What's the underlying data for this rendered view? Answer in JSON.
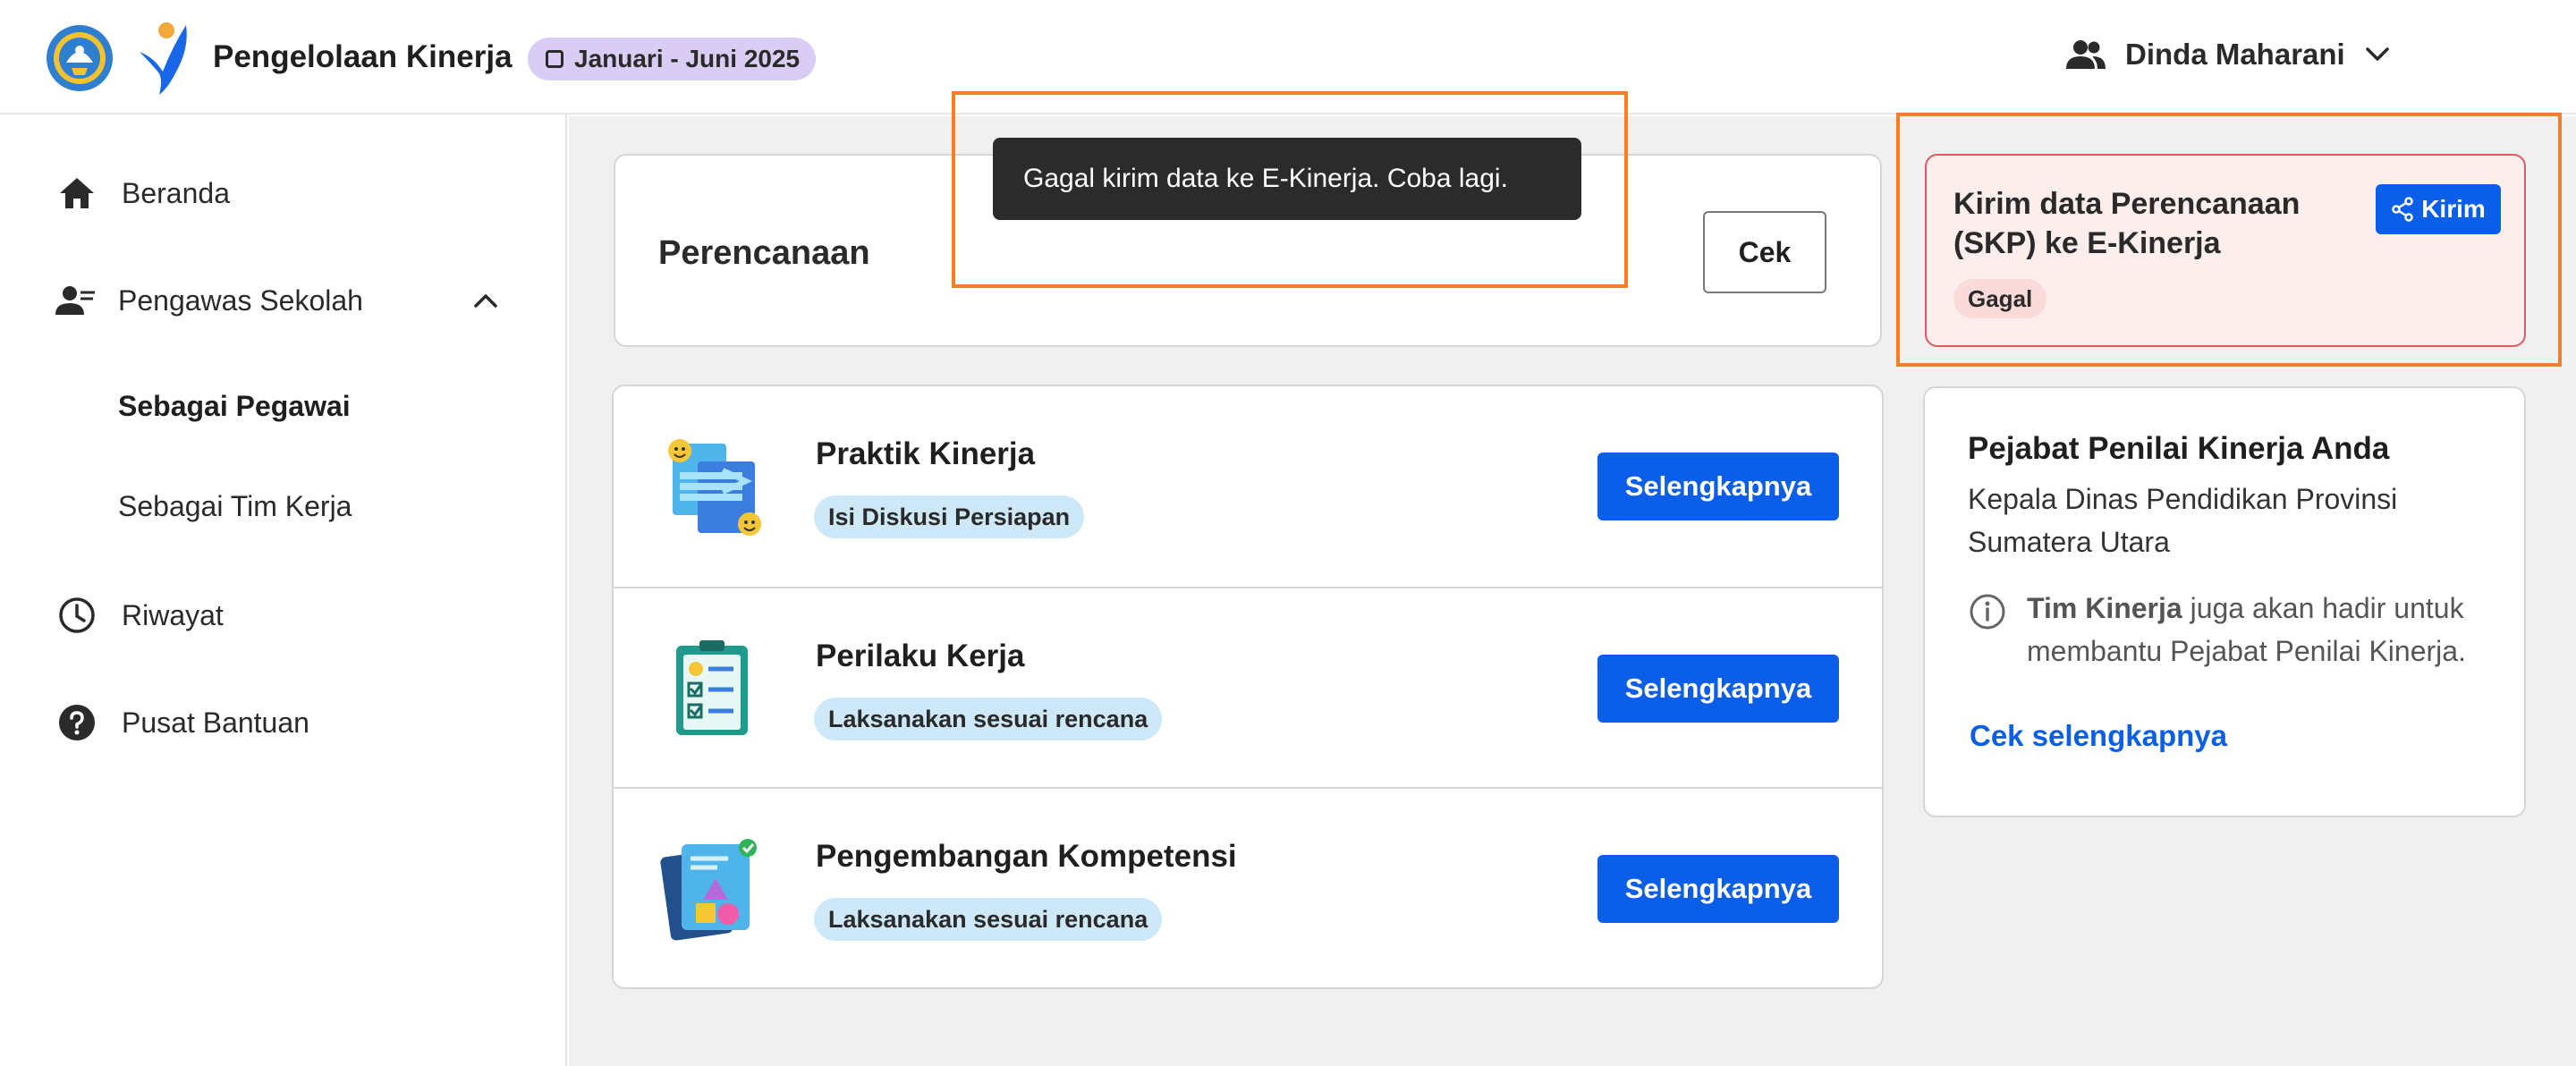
{
  "header": {
    "app_title": "Pengelolaan Kinerja",
    "period_label": "Januari - Juni 2025",
    "user_name": "Dinda Maharani"
  },
  "sidebar": {
    "items": [
      {
        "label": "Beranda",
        "icon": "home-icon"
      },
      {
        "label": "Pengawas Sekolah",
        "icon": "users-icon",
        "expanded": true
      },
      {
        "label": "Riwayat",
        "icon": "clock-icon"
      },
      {
        "label": "Pusat Bantuan",
        "icon": "help-icon"
      }
    ],
    "subitems": [
      {
        "label": "Sebagai Pegawai",
        "active": true
      },
      {
        "label": "Sebagai Tim Kerja",
        "active": false
      }
    ]
  },
  "toast": {
    "message": "Gagal kirim data ke E-Kinerja. Coba lagi."
  },
  "plan_card": {
    "title": "Perencanaan",
    "button_label": "Cek"
  },
  "rows": [
    {
      "title": "Praktik Kinerja",
      "badge": "Isi Diskusi Persiapan",
      "button_label": "Selengkapnya"
    },
    {
      "title": "Perilaku Kerja",
      "badge": "Laksanakan sesuai rencana",
      "button_label": "Selengkapnya"
    },
    {
      "title": "Pengembangan Kompetensi",
      "badge": "Laksanakan sesuai rencana",
      "button_label": "Selengkapnya"
    }
  ],
  "send_card": {
    "title": "Kirim data Perencanaan (SKP) ke E-Kinerja",
    "button_label": "Kirim",
    "status": "Gagal"
  },
  "pejabat_card": {
    "title": "Pejabat Penilai Kinerja Anda",
    "subtitle": "Kepala Dinas Pendidikan Provinsi Sumatera Utara",
    "info_bold": "Tim Kinerja",
    "info_rest": " juga akan hadir untuk membantu Pejabat Penilai Kinerja.",
    "link_label": "Cek selengkapnya"
  },
  "colors": {
    "primary": "#0b5ee8",
    "highlight": "#f47f2a",
    "error_border": "#e05a63",
    "error_bg": "#fdeeee",
    "badge_blue": "#cde8f8",
    "chip_purple": "#d9ccf5"
  }
}
